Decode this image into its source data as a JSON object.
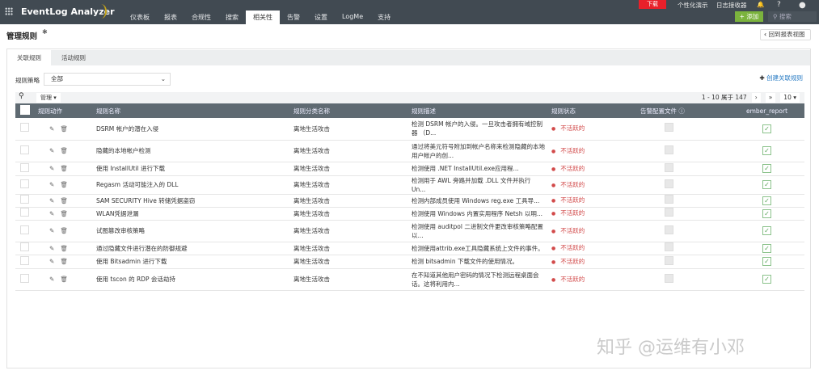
{
  "header": {
    "app_name": "EventLog Analyzer",
    "nav": [
      "仪表板",
      "报表",
      "合规性",
      "搜索",
      "相关性",
      "告警",
      "设置",
      "LogMe",
      "支持"
    ],
    "active_nav": "相关性",
    "download": "下载",
    "demo": "个性化演示",
    "log_receiver": "日志接收器",
    "help": "?",
    "add": "+ 添加",
    "search_placeholder": "搜索"
  },
  "page": {
    "title": "管理规则",
    "back": "回到报表视图",
    "tabs": [
      "关联规则",
      "活动规则"
    ],
    "filter_label": "规则策略",
    "filter_value": "全部",
    "create": "创建关联规则",
    "manage": "管理",
    "pagination": "1 - 10 属于 147",
    "page_size": "10"
  },
  "table": {
    "headers": [
      "规则动作",
      "规则名称",
      "规则分类名称",
      "规则描述",
      "规则状态",
      "告警配置文件",
      "ember_report"
    ],
    "rows": [
      {
        "name": "DSRM 帐户的潜在入侵",
        "category": "离地生活攻击",
        "desc": "检测 DSRM 帐户的入侵。一旦攻击者拥有域控制器 （D...",
        "status": "不活跃的"
      },
      {
        "name": "隐藏的本地帐户检测",
        "category": "离地生活攻击",
        "desc": "通过将美元符号附加到帐户名称来检测隐藏的本地用户帐户的创...",
        "status": "不活跃的"
      },
      {
        "name": "使用 InstallUtil 进行下载",
        "category": "离地生活攻击",
        "desc": "检测使用 .NET InstallUtil.exe应用程...",
        "status": "不活跃的"
      },
      {
        "name": "Regasm 活动可能注入的 DLL",
        "category": "离地生活攻击",
        "desc": "检测用于 AWL 旁路并加载 .DLL 文件并执行 Un...",
        "status": "不活跃的"
      },
      {
        "name": "SAM SECURITY Hive 转储凭据盗窃",
        "category": "离地生活攻击",
        "desc": "检测内部成员使用 Windows reg.exe 工具导...",
        "status": "不活跃的"
      },
      {
        "name": "WLAN凭据泄漏",
        "category": "离地生活攻击",
        "desc": "检测使用 Windows 内置实用程序 Netsh 以明...",
        "status": "不活跃的"
      },
      {
        "name": "试图篡改审核策略",
        "category": "离地生活攻击",
        "desc": "检测使用 auditpol 二进制文件更改审核策略配置以...",
        "status": "不活跃的"
      },
      {
        "name": "通过隐藏文件进行潜在的防御规避",
        "category": "离地生活攻击",
        "desc": "检测使用attrib.exe工具隐藏系统上文件的事件。",
        "status": "不活跃的"
      },
      {
        "name": "使用 Bitsadmin 进行下载",
        "category": "离地生活攻击",
        "desc": "检测 bitsadmin 下载文件的使用情况。",
        "status": "不活跃的"
      },
      {
        "name": "使用 tscon 的 RDP 会话劫持",
        "category": "离地生活攻击",
        "desc": "在不知道其他用户密码的情况下检测远程桌面会话。这将利用内...",
        "status": "不活跃的"
      }
    ]
  },
  "watermark": "知乎 @运维有小邓"
}
